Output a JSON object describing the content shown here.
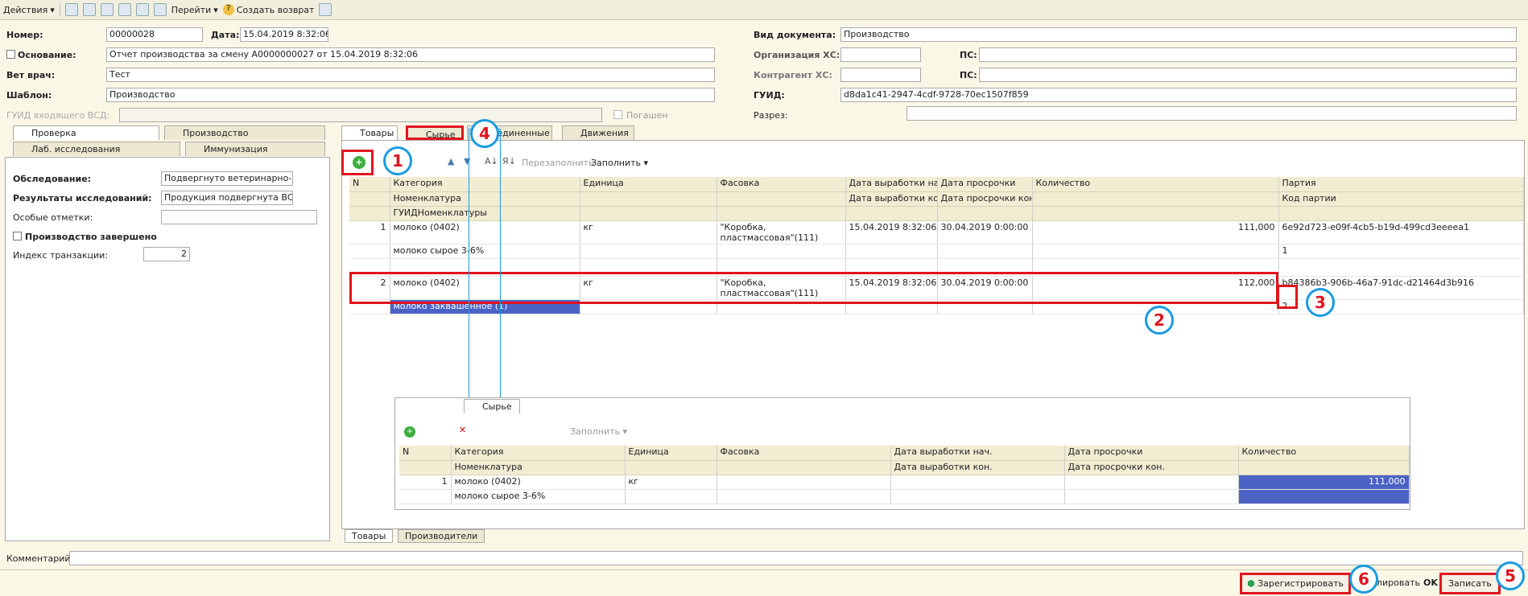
{
  "toolbar": {
    "actions": "Действия",
    "goto": "Перейти",
    "create_return": "Создать возврат"
  },
  "header": {
    "number_label": "Номер:",
    "number": "00000028",
    "date_label": "Дата:",
    "date": "15.04.2019  8:32:06",
    "basis_label": "Основание:",
    "basis": "Отчет производства за смену A0000000027 от 15.04.2019 8:32:06",
    "vet_label": "Вет врач:",
    "vet": "Тест",
    "template_label": "Шаблон:",
    "template": "Производство",
    "guid_in_label": "ГУИД входящего ВСД:",
    "repaid": "Погашен",
    "doc_type_label": "Вид документа:",
    "doc_type": "Производство",
    "org_label": "Организация ХС:",
    "ps_label": "ПС:",
    "contr_label": "Контрагент ХС:",
    "guid_label": "ГУИД:",
    "guid": "d8da1c41-2947-4cdf-9728-70ec1507f859",
    "cut_label": "Разрез:"
  },
  "left": {
    "tabs": [
      "Проверка",
      "Производство",
      "Лаб. исследования",
      "Иммунизация"
    ],
    "exam_label": "Обследование:",
    "exam": "Подвергнуто ветеринарно-сани",
    "results_label": "Результаты исследований:",
    "results": "Продукция подвергнута ВСЭ в п",
    "notes_label": "Особые отметки:",
    "done_label": "Производство завершено",
    "tx_label": "Индекс транзакции:",
    "tx": "2"
  },
  "main": {
    "tabs": [
      "Товары",
      "Сырье",
      "Соединенные",
      "Движения"
    ],
    "refill": "Перезаполнить",
    "fill": "Заполнить",
    "cols": {
      "n": "N",
      "cat": "Категория",
      "nom": "Номенклатура",
      "guid": "ГУИДНоменклатуры",
      "unit": "Единица",
      "pack": "Фасовка",
      "prod_start": "Дата выработки нач.",
      "prod_end": "Дата выработки кон.",
      "exp": "Дата просрочки",
      "exp_end": "Дата просрочки кон.",
      "qty": "Количество",
      "batch": "Партия",
      "batch_code": "Код партии"
    },
    "rows": [
      {
        "n": "1",
        "cat": "молоко (0402)",
        "nom": "молоко сырое 3-6%",
        "unit": "кг",
        "pack": "\"Коробка, пластмассовая\"(111)",
        "prod": "15.04.2019 8:32:06",
        "exp": "30.04.2019 0:00:00",
        "qty": "111,000",
        "batch": "6e92d723-e09f-4cb5-b19d-499cd3eeeea1",
        "code": "1"
      },
      {
        "n": "2",
        "cat": "молоко (0402)",
        "nom": "молоко заквашенное (1)",
        "unit": "кг",
        "pack": "\"Коробка, пластмассовая\"(111)",
        "prod": "15.04.2019 8:32:06",
        "exp": "30.04.2019 0:00:00",
        "qty": "112,000",
        "batch": "b84386b3-906b-46a7-91dc-d21464d3b916",
        "code": "2"
      }
    ],
    "bottom_tabs": [
      "Товары",
      "Производители"
    ]
  },
  "inset": {
    "tab": "Сырье",
    "fill": "Заполнить",
    "cols": {
      "n": "N",
      "cat": "Категория",
      "nom": "Номенклатура",
      "unit": "Единица",
      "pack": "Фасовка",
      "prod_start": "Дата выработки нач.",
      "prod_end": "Дата выработки кон.",
      "exp": "Дата просрочки",
      "exp_end": "Дата просрочки кон.",
      "qty": "Количество"
    },
    "row": {
      "n": "1",
      "cat": "молоко (0402)",
      "nom": "молоко сырое 3-6%",
      "unit": "кг",
      "qty": "111,000"
    }
  },
  "footer": {
    "comment_label": "Комментарий:",
    "register": "Зарегистрировать",
    "publish": "лировать",
    "ok": "OK",
    "save": "Записать"
  },
  "callouts": [
    "1",
    "2",
    "3",
    "4",
    "5",
    "6"
  ]
}
